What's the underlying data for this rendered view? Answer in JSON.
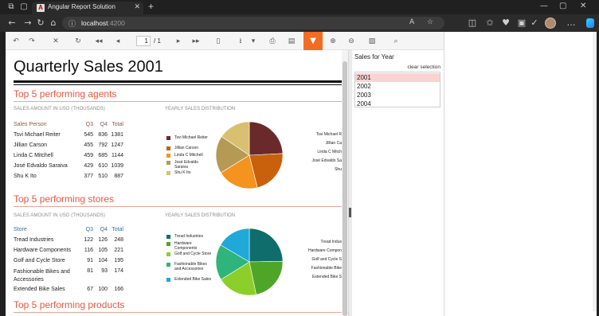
{
  "browser": {
    "tab_title": "Angular Report Solution",
    "url_host": "localhost",
    "url_port": ":4200"
  },
  "toolbar": {
    "page_current": "1",
    "page_total": "/ 1"
  },
  "report": {
    "title": "Quarterly Sales 2001",
    "agents": {
      "title": "Top 5 performing agents",
      "sub_table": "SALES AMOUNT IN USD (THOUSANDS)",
      "sub_chart": "YEARLY SALES DISTRIBUTION",
      "headers": [
        "Sales Person",
        "Q3",
        "Q4",
        "Total"
      ],
      "rows": [
        [
          "Tsvi Michael Reiter",
          "545",
          "836",
          "1381"
        ],
        [
          "Jillian  Carson",
          "455",
          "792",
          "1247"
        ],
        [
          "Linda C Mitchell",
          "459",
          "685",
          "1144"
        ],
        [
          "José Edvaldo Saraiva",
          "429",
          "610",
          "1039"
        ],
        [
          "Shu K Ito",
          "377",
          "510",
          "887"
        ]
      ],
      "legend": [
        "Tsvi Michael Reiter",
        "Jillian  Carson",
        "Linda C Mitchell",
        "José Edvaldo Saraiva",
        "Shu K Ito"
      ],
      "ext_labels": [
        "Tsvi Michael R",
        "Jillian  Ca",
        "Linda C Mitch",
        "José Edvaldo Sa",
        "Shu"
      ],
      "colors": [
        "#6b2a2a",
        "#c9600c",
        "#f4931e",
        "#b49a55",
        "#d8c070"
      ]
    },
    "stores": {
      "title": "Top 5 performing stores",
      "sub_table": "SALES AMOUNT IN USD (THOUSANDS)",
      "sub_chart": "YEARLY SALES DISTRIBUTION",
      "headers": [
        "Store",
        "Q3",
        "Q4",
        "Total"
      ],
      "rows": [
        [
          "Tread Industries",
          "122",
          "126",
          "248"
        ],
        [
          "Hardware Components",
          "116",
          "105",
          "221"
        ],
        [
          "Golf and Cycle Store",
          "91",
          "104",
          "195"
        ],
        [
          "Fashionable Bikes and Accessories",
          "81",
          "93",
          "174"
        ],
        [
          "Extended Bike Sales",
          "67",
          "100",
          "166"
        ]
      ],
      "legend": [
        "Tread Industries",
        "Hardware Components",
        "Golf and Cycle Store",
        "Fashionable Bikes and Accessories",
        "Extended Bike Sales"
      ],
      "ext_labels": [
        "Tread Indus",
        "Hardware Compon",
        "Golf and Cycle S",
        "Fashionable Bike",
        "Extended Bike S"
      ],
      "colors": [
        "#0f6e6b",
        "#4fa528",
        "#8ccf2a",
        "#2fb47b",
        "#1fa9d9"
      ]
    },
    "products": {
      "title": "Top 5 performing products"
    }
  },
  "panel": {
    "title": "Sales for Year",
    "clear": "clear selection",
    "years": [
      "2001",
      "2002",
      "2003",
      "2004"
    ]
  }
}
